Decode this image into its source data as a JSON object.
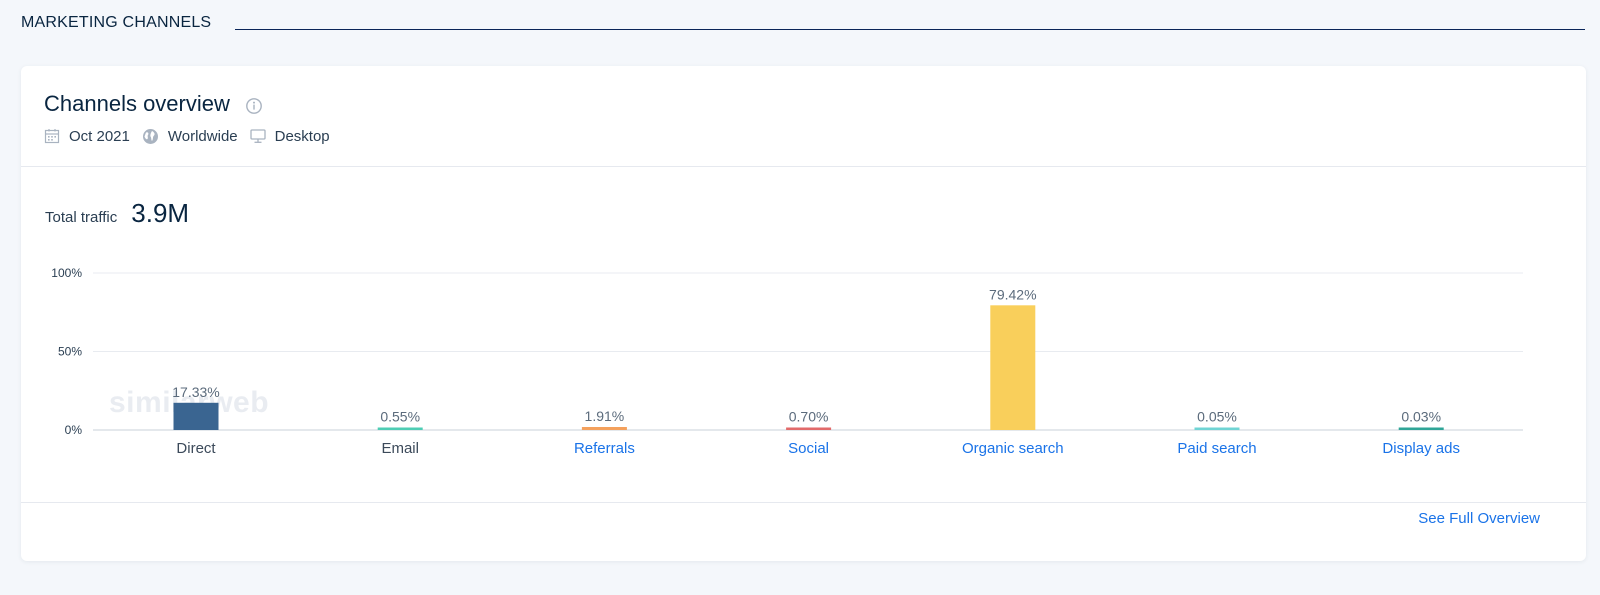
{
  "section": {
    "title": "MARKETING CHANNELS"
  },
  "card": {
    "title": "Channels overview",
    "filters": {
      "date": "Oct 2021",
      "region": "Worldwide",
      "device": "Desktop"
    },
    "total_label": "Total traffic",
    "total_value": "3.9M",
    "watermark": "similarweb",
    "see_full": "See Full Overview"
  },
  "colors": {
    "link": "#1a73e8",
    "text": "#2a3e52"
  },
  "chart_data": {
    "type": "bar",
    "categories": [
      "Direct",
      "Email",
      "Referrals",
      "Social",
      "Organic search",
      "Paid search",
      "Display ads"
    ],
    "values": [
      17.33,
      0.55,
      1.91,
      0.7,
      79.42,
      0.05,
      0.03
    ],
    "value_labels": [
      "17.33%",
      "0.55%",
      "1.91%",
      "0.70%",
      "79.42%",
      "0.05%",
      "0.03%"
    ],
    "bar_colors": [
      "#3a6591",
      "#4ecdb4",
      "#f4a15d",
      "#e26a6a",
      "#f9cf5b",
      "#6fd4d4",
      "#2fa597"
    ],
    "category_links": [
      false,
      false,
      true,
      true,
      true,
      true,
      true
    ],
    "yticks": [
      "0%",
      "50%",
      "100%"
    ],
    "ylim": [
      0,
      100
    ],
    "grid": true
  }
}
